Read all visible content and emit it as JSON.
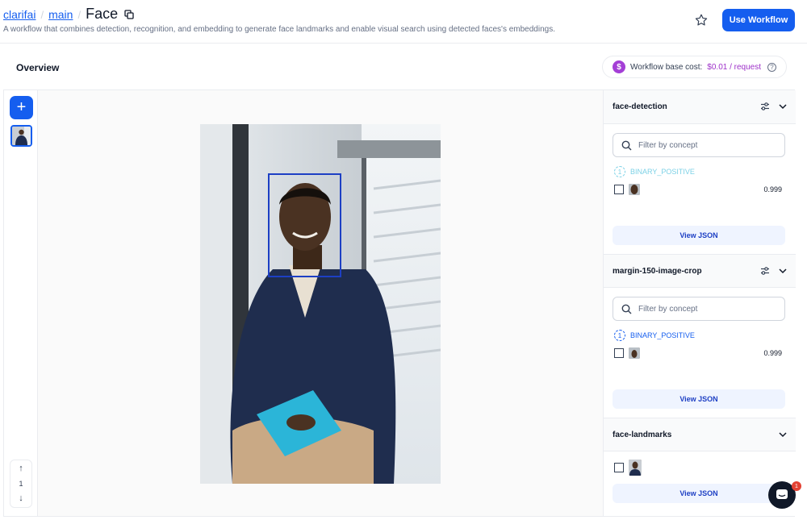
{
  "breadcrumb": {
    "org": "clarifai",
    "app": "main",
    "title": "Face"
  },
  "description": "A workflow that combines detection, recognition, and embedding to generate face landmarks and enable visual search using detected faces's embeddings.",
  "header": {
    "use_workflow_label": "Use Workflow"
  },
  "overview": {
    "title": "Overview",
    "cost_label": "Workflow base cost:",
    "cost_value": "$0.01 / request",
    "cost_icon": "$"
  },
  "left_rail": {
    "page_number": "1"
  },
  "panels": [
    {
      "name": "face-detection",
      "filter_placeholder": "Filter by concept",
      "concept": "BINARY_POSITIVE",
      "concept_color": "#7cd1e6",
      "score": "0.999",
      "json_label": "View JSON"
    },
    {
      "name": "margin-150-image-crop",
      "filter_placeholder": "Filter by concept",
      "concept": "BINARY_POSITIVE",
      "concept_color": "#155eef",
      "score": "0.999",
      "json_label": "View JSON"
    },
    {
      "name": "face-landmarks",
      "json_label": "View JSON"
    }
  ],
  "chat": {
    "badge": "1"
  },
  "colors": {
    "accent": "#155eef",
    "cost": "#9e31c9",
    "bbox": "#1d3fc4"
  }
}
